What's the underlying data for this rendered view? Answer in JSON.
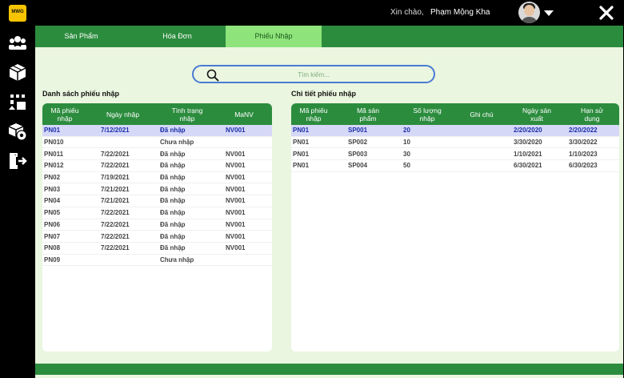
{
  "app": {
    "logo_text": "MWG"
  },
  "header": {
    "greeting": "Xin chào,",
    "user_name": "Phạm Mộng Kha"
  },
  "colors": {
    "accent": "#2c8c3e",
    "active_tab": "#8ee47a",
    "selected_row": "#d6d8f8",
    "selected_text": "#1a2ea8",
    "search_border": "#4a7bd4"
  },
  "sidebar": {
    "items": [
      {
        "icon": "users-icon"
      },
      {
        "icon": "box-icon"
      },
      {
        "icon": "import-icon"
      },
      {
        "icon": "box-settings-icon"
      },
      {
        "icon": "logout-icon"
      }
    ]
  },
  "tabs": [
    {
      "label": "Sản Phẩm",
      "active": false
    },
    {
      "label": "Hóa Đơn",
      "active": false
    },
    {
      "label": "Phiếu Nhập",
      "active": true
    }
  ],
  "search": {
    "placeholder": "Tìm kiếm..."
  },
  "left_panel": {
    "title": "Danh sách phiếu nhập",
    "columns": [
      "Mã phiếu\nnhập",
      "Ngày nhập",
      "Tình trạng\nnhập",
      "MaNV"
    ],
    "rows": [
      [
        "PN01",
        "7/12/2021",
        "Đã nhập",
        "NV001"
      ],
      [
        "PN010",
        "",
        "Chưa nhập",
        ""
      ],
      [
        "PN011",
        "7/22/2021",
        "Đã nhập",
        "NV001"
      ],
      [
        "PN012",
        "7/22/2021",
        "Đã nhập",
        "NV001"
      ],
      [
        "PN02",
        "7/19/2021",
        "Đã nhập",
        "NV001"
      ],
      [
        "PN03",
        "7/21/2021",
        "Đã nhập",
        "NV001"
      ],
      [
        "PN04",
        "7/21/2021",
        "Đã nhập",
        "NV001"
      ],
      [
        "PN05",
        "7/22/2021",
        "Đã nhập",
        "NV001"
      ],
      [
        "PN06",
        "7/22/2021",
        "Đã nhập",
        "NV001"
      ],
      [
        "PN07",
        "7/22/2021",
        "Đã nhập",
        "NV001"
      ],
      [
        "PN08",
        "7/22/2021",
        "Đã nhập",
        "NV001"
      ],
      [
        "PN09",
        "",
        "Chưa nhập",
        ""
      ]
    ],
    "selected_row": 0
  },
  "right_panel": {
    "title": "Chi tiết phiếu nhập",
    "columns": [
      "Mã phiếu\nnhập",
      "Mã sản\nphẩm",
      "Số lượng\nnhập",
      "Ghi chú",
      "Ngày sản\nxuất",
      "Hạn sử\ndụng"
    ],
    "rows": [
      [
        "PN01",
        "SP001",
        "20",
        "",
        "2/20/2020",
        "2/20/2022"
      ],
      [
        "PN01",
        "SP002",
        "10",
        "",
        "3/30/2020",
        "3/30/2022"
      ],
      [
        "PN01",
        "SP003",
        "30",
        "",
        "1/10/2021",
        "1/10/2023"
      ],
      [
        "PN01",
        "SP004",
        "50",
        "",
        "6/30/2021",
        "6/30/2023"
      ]
    ],
    "selected_row": 0
  }
}
